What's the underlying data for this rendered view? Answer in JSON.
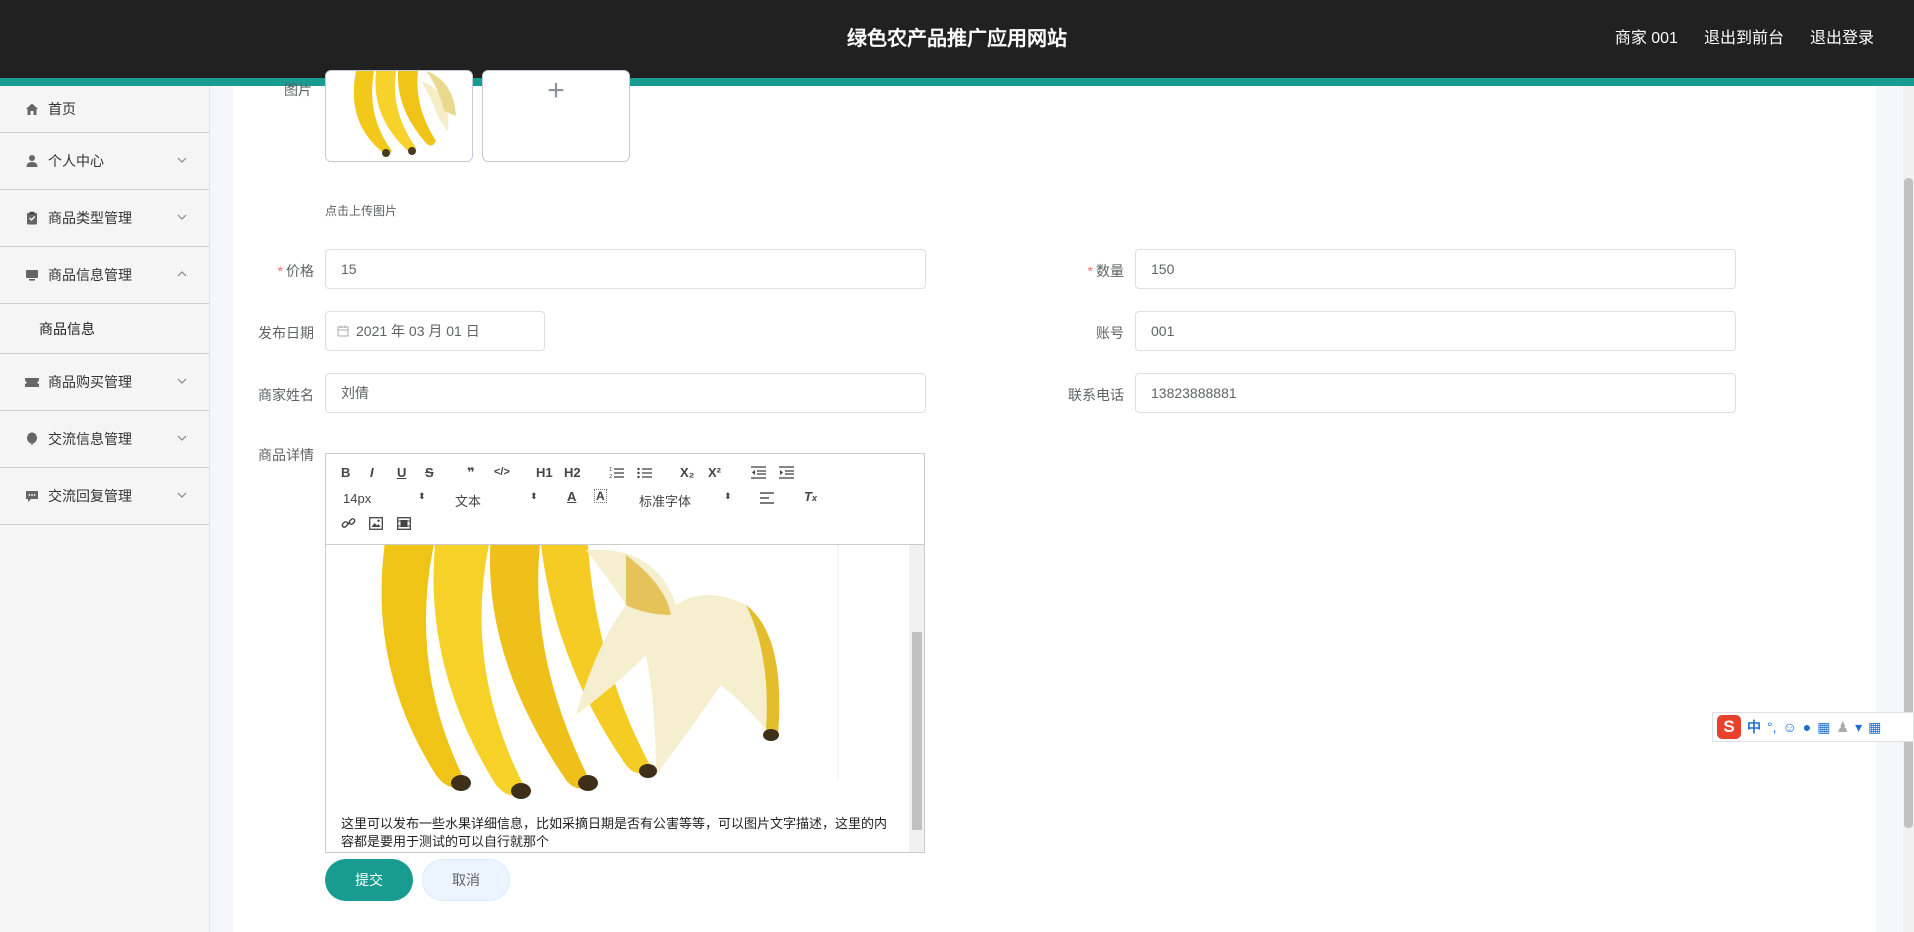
{
  "header": {
    "title": "绿色农产品推广应用网站",
    "user": "商家 001",
    "to_front": "退出到前台",
    "logout": "退出登录"
  },
  "sidebar": {
    "items": [
      {
        "label": "首页",
        "icon": "home-icon"
      },
      {
        "label": "个人中心",
        "icon": "user-icon"
      },
      {
        "label": "商品类型管理",
        "icon": "clipboard-icon"
      },
      {
        "label": "商品信息管理",
        "icon": "monitor-icon",
        "expanded": true,
        "children": [
          "商品信息"
        ]
      },
      {
        "label": "商品购买管理",
        "icon": "ticket-icon"
      },
      {
        "label": "交流信息管理",
        "icon": "balloon-icon"
      },
      {
        "label": "交流回复管理",
        "icon": "chat-icon"
      }
    ]
  },
  "form": {
    "image_label": "图片",
    "upload_hint": "点击上传图片",
    "upload_plus": "+",
    "price_label": "价格",
    "price_value": "15",
    "quantity_label": "数量",
    "quantity_value": "150",
    "publish_date_label": "发布日期",
    "publish_date_value": "2021 年 03 月 01 日",
    "account_label": "账号",
    "account_value": "001",
    "merchant_name_label": "商家姓名",
    "merchant_name_value": "刘倩",
    "phone_label": "联系电话",
    "phone_value": "13823888881",
    "detail_label": "商品详情",
    "required_mark": "*"
  },
  "editor": {
    "toolbar_row1": [
      "B",
      "I",
      "U",
      "S",
      "❞",
      "</>",
      "H1",
      "H2",
      "ordered-list",
      "bullet-list",
      "X₂",
      "X²",
      "outdent",
      "indent"
    ],
    "font_size": "14px",
    "block_type": "文本",
    "font_family": "标准字体",
    "content_text": "这里可以发布一些水果详细信息，比如采摘日期是否有公害等等，可以图片文字描述，这里的内容都是要用于测试的可以自行就那个"
  },
  "buttons": {
    "submit": "提交",
    "cancel": "取消"
  },
  "ime": {
    "logo": "S",
    "lang": "中"
  },
  "colors": {
    "header_bg": "#212121",
    "accent": "#189b90",
    "required": "#f56c6c"
  }
}
